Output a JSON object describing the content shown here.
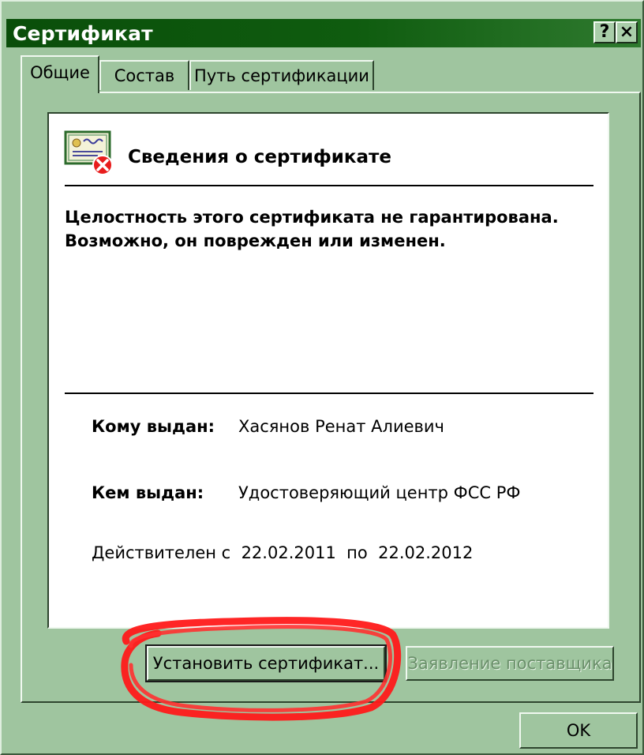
{
  "window": {
    "title": "Сертификат",
    "help_label": "?",
    "close_label": "×"
  },
  "tabs": [
    {
      "label": "Общие",
      "active": true
    },
    {
      "label": "Состав",
      "active": false
    },
    {
      "label": "Путь сертификации",
      "active": false
    }
  ],
  "certificate": {
    "header": "Сведения о сертификате",
    "icon": "certificate-error-icon",
    "warning": "Целостность этого сертификата не гарантирована. Возможно, он поврежден или изменен.",
    "issued_to_label": "Кому выдан:",
    "issued_to": "Хасянов Ренат Алиевич",
    "issued_by_label": "Кем выдан:",
    "issued_by": "Удостоверяющий центр ФСС РФ",
    "validity": "Действителен с  22.02.2011  по  22.02.2012"
  },
  "buttons": {
    "install": "Установить сертификат...",
    "issuer_statement": "Заявление поставщика",
    "ok": "OK"
  },
  "colors": {
    "window_bg": "#9fc59f",
    "titlebar": "#0f5c0f",
    "annotation": "#ff0000"
  }
}
